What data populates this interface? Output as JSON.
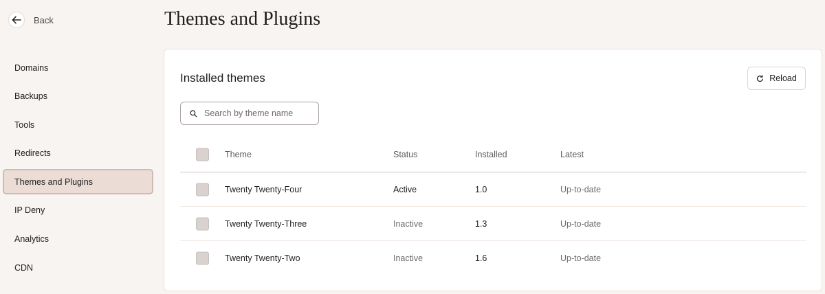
{
  "back": {
    "label": "Back"
  },
  "sidebar": {
    "items": [
      {
        "label": "Domains",
        "active": false
      },
      {
        "label": "Backups",
        "active": false
      },
      {
        "label": "Tools",
        "active": false
      },
      {
        "label": "Redirects",
        "active": false
      },
      {
        "label": "Themes and Plugins",
        "active": true
      },
      {
        "label": "IP Deny",
        "active": false
      },
      {
        "label": "Analytics",
        "active": false
      },
      {
        "label": "CDN",
        "active": false
      }
    ]
  },
  "page": {
    "title": "Themes and Plugins"
  },
  "card": {
    "title": "Installed themes",
    "reload_label": "Reload",
    "search_placeholder": "Search by theme name"
  },
  "table": {
    "headers": {
      "theme": "Theme",
      "status": "Status",
      "installed": "Installed",
      "latest": "Latest"
    },
    "rows": [
      {
        "theme": "Twenty Twenty-Four",
        "status": "Active",
        "installed": "1.0",
        "latest": "Up-to-date"
      },
      {
        "theme": "Twenty Twenty-Three",
        "status": "Inactive",
        "installed": "1.3",
        "latest": "Up-to-date"
      },
      {
        "theme": "Twenty Twenty-Two",
        "status": "Inactive",
        "installed": "1.6",
        "latest": "Up-to-date"
      }
    ]
  },
  "icons": {
    "back": "arrow-left-icon",
    "reload": "refresh-icon",
    "search": "search-icon"
  },
  "colors": {
    "background": "#f8f4f1",
    "active_nav": "#ebddd6",
    "active_nav_border": "#cdbcb3",
    "checkbox": "#d9d2ce"
  }
}
